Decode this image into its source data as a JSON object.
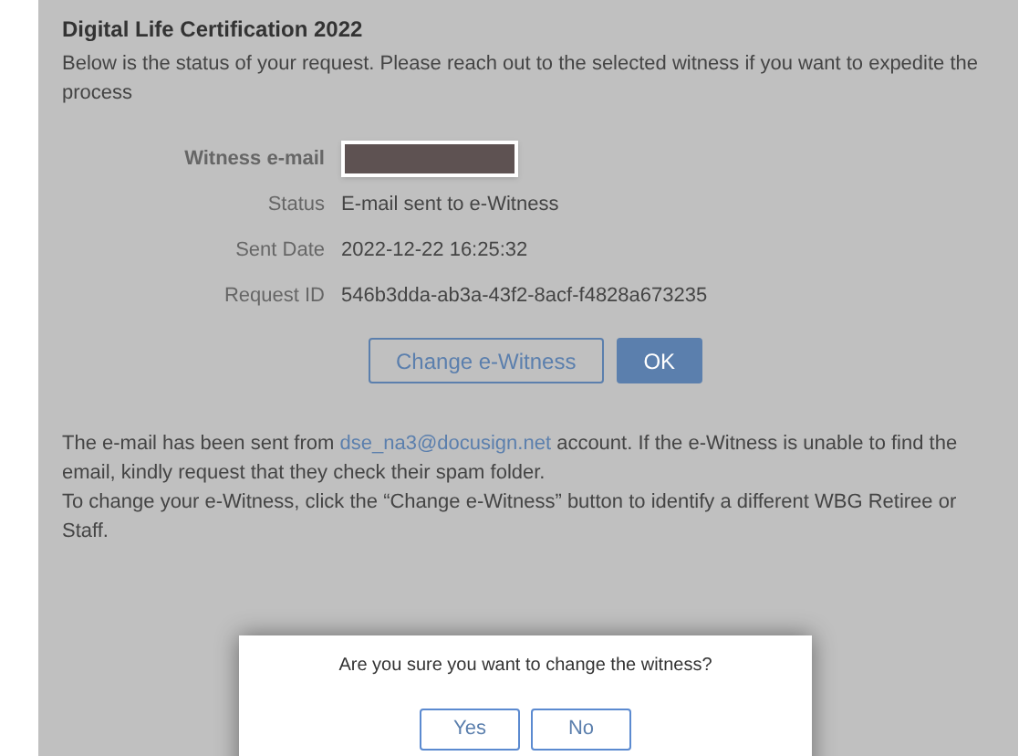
{
  "title": "Digital Life Certification 2022",
  "intro": "Below is the status of your request. Please reach out to the selected witness if you want to expedite the process",
  "fields": [
    {
      "kind": "input",
      "label": "Witness e-mail",
      "redacted": true
    },
    {
      "kind": "text",
      "label": "Status",
      "value": "E-mail sent to e-Witness"
    },
    {
      "kind": "text",
      "label": "Sent Date",
      "value": "2022-12-22 16:25:32"
    },
    {
      "kind": "text",
      "label": "Request ID",
      "value": "546b3dda-ab3a-43f2-8acf-f4828a673235"
    }
  ],
  "buttons": [
    {
      "label": "Change e-Witness",
      "kind": "outline"
    },
    {
      "label": "OK",
      "kind": "primary"
    }
  ],
  "note": {
    "before": "The e-mail has been sent from ",
    "link": "dse_na3@docusign.net",
    "after": " account. If the e-Witness is unable to find the email, kindly request that they check their spam folder.",
    "second": "To change your e-Witness, click the “Change e-Witness” button to identify a different WBG Retiree or Staff."
  },
  "dialog": {
    "message": "Are you sure you want to change the witness?",
    "buttons": [
      "Yes",
      "No"
    ]
  }
}
